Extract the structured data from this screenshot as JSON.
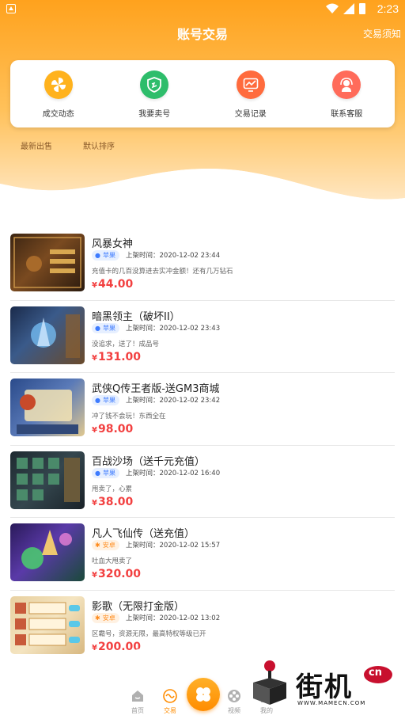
{
  "status_bar": {
    "time": "2:23"
  },
  "header": {
    "title": "账号交易",
    "notice": "交易须知"
  },
  "quick_actions": [
    {
      "label": "成交动态",
      "icon": "pinwheel-icon",
      "color": "#ffb21d"
    },
    {
      "label": "我要卖号",
      "icon": "shield-icon",
      "color": "#2ebd6b"
    },
    {
      "label": "交易记录",
      "icon": "chart-monitor-icon",
      "color": "#ff6b3d"
    },
    {
      "label": "联系客服",
      "icon": "headset-icon",
      "color": "#ff6b5a"
    }
  ],
  "sort_tabs": [
    "最新出售",
    "默认排序"
  ],
  "listed_label": "上架时间：",
  "currency": "¥",
  "listings": [
    {
      "name": "风暴女神",
      "platform": "苹果",
      "platform_type": "ios",
      "time": "2020-12-02 23:44",
      "desc": "充值卡的几百没算进去实冲金额！还有几万钻石",
      "price": "44.00"
    },
    {
      "name": "暗黑领主（破坏II）",
      "platform": "苹果",
      "platform_type": "ios",
      "time": "2020-12-02 23:43",
      "desc": "没追求，送了！成品号",
      "price": "131.00"
    },
    {
      "name": "武侠Q传王者版-送GM3商城",
      "platform": "苹果",
      "platform_type": "ios",
      "time": "2020-12-02 23:42",
      "desc": "冲了钱不会玩！东西全在",
      "price": "98.00"
    },
    {
      "name": "百战沙场（送千元充值）",
      "platform": "苹果",
      "platform_type": "ios",
      "time": "2020-12-02 16:40",
      "desc": "甩卖了，心累",
      "price": "38.00"
    },
    {
      "name": "凡人飞仙传（送充值）",
      "platform": "安卓",
      "platform_type": "android",
      "time": "2020-12-02 15:57",
      "desc": "吐血大甩卖了",
      "price": "320.00"
    },
    {
      "name": "影歌（无限打金版）",
      "platform": "安卓",
      "platform_type": "android",
      "time": "2020-12-02 13:02",
      "desc": "区霸号，资源无限，最高特权等级已开",
      "price": "200.00"
    }
  ],
  "bottom_nav": [
    {
      "label": "首页",
      "active": false
    },
    {
      "label": "交易",
      "active": true
    },
    {
      "label": "视频",
      "active": false
    },
    {
      "label": "我的",
      "active": false
    }
  ],
  "watermark": {
    "brand": "街机",
    "domain": "WWW.MAMECN.COM",
    "tag": "cn"
  },
  "colors": {
    "accent": "#ff9a1f",
    "price": "#f24040"
  }
}
